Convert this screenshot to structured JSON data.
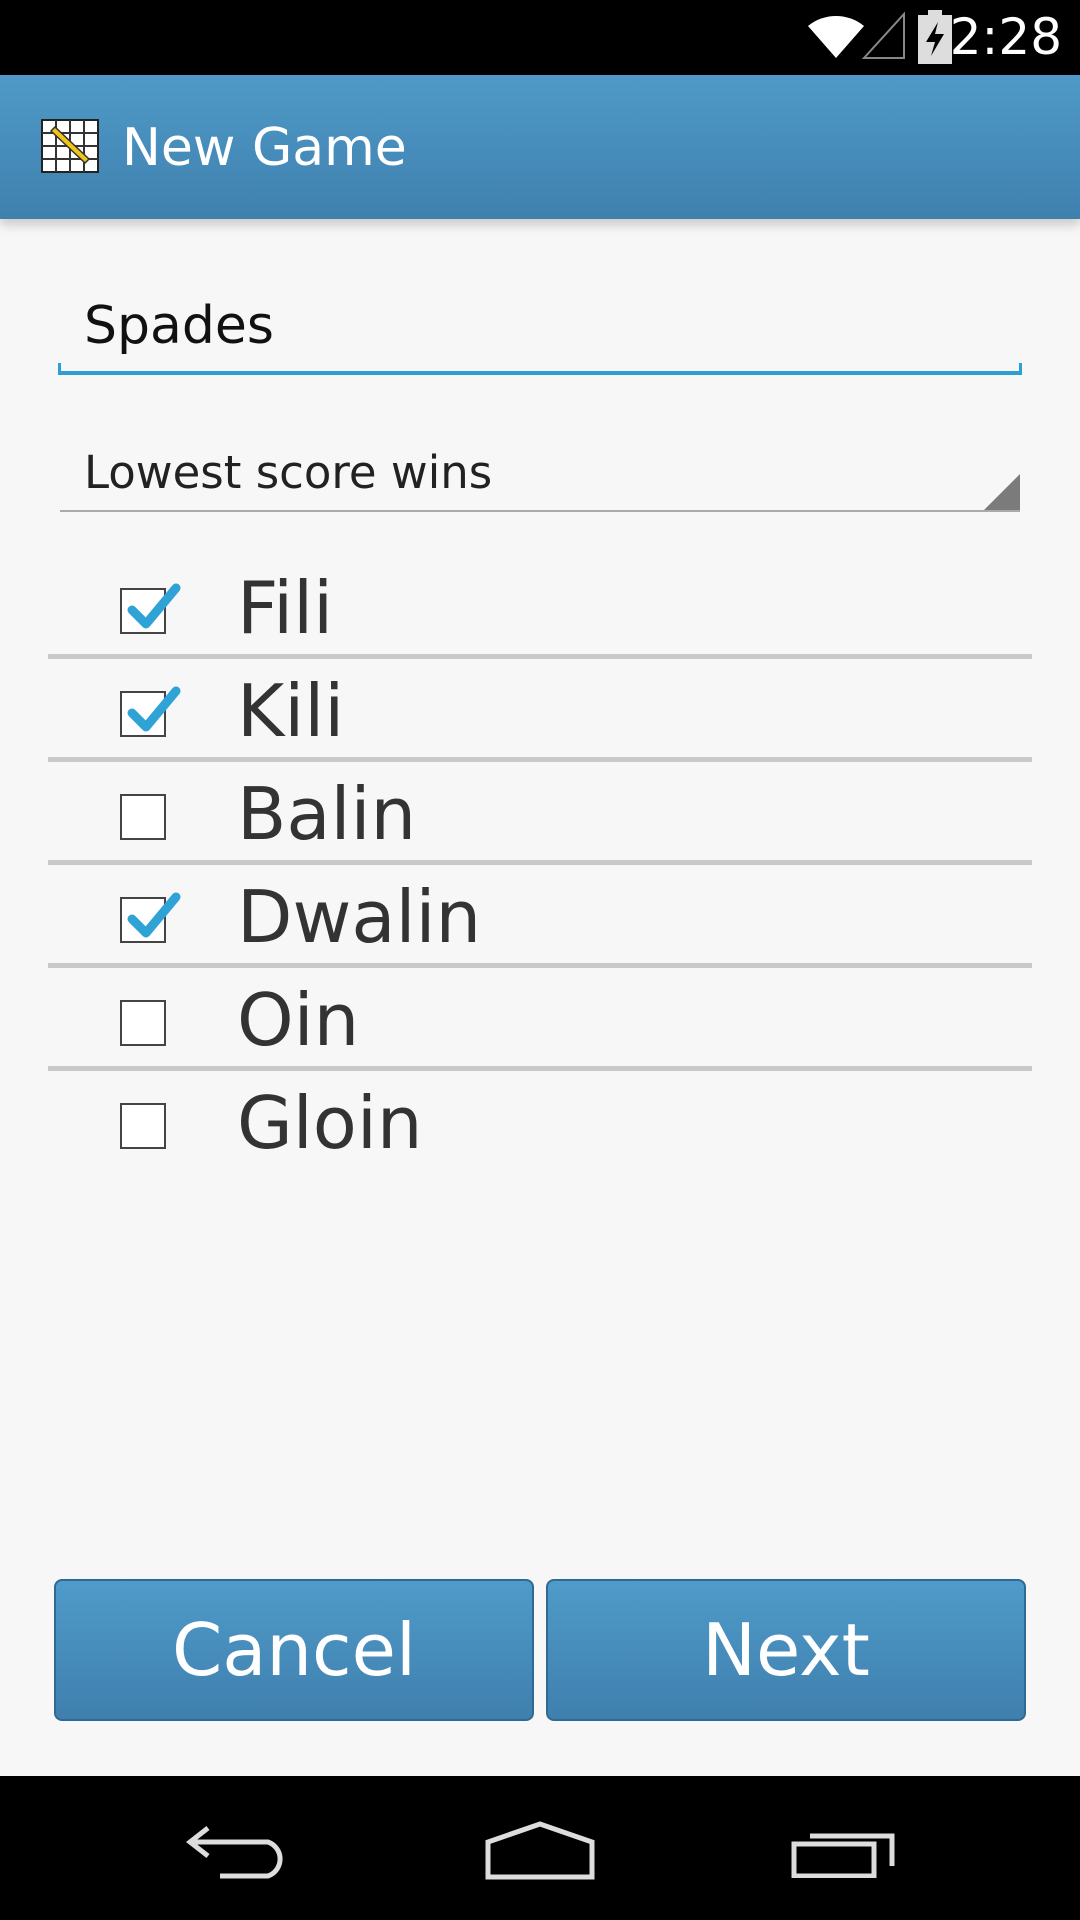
{
  "status_bar": {
    "time": "2:28",
    "icons": [
      "wifi-icon",
      "signal-icon",
      "battery-charging-icon"
    ]
  },
  "action_bar": {
    "title": "New Game",
    "icon": "app-scoresheet-icon"
  },
  "game_name": {
    "value": "Spades",
    "placeholder": ""
  },
  "scoring_spinner": {
    "selected": "Lowest score wins"
  },
  "players": [
    {
      "name": "Fili",
      "checked": true
    },
    {
      "name": "Kili",
      "checked": true
    },
    {
      "name": "Balin",
      "checked": false
    },
    {
      "name": "Dwalin",
      "checked": true
    },
    {
      "name": "Oin",
      "checked": false
    },
    {
      "name": "Gloin",
      "checked": false
    }
  ],
  "buttons": {
    "cancel": "Cancel",
    "next": "Next"
  },
  "nav_bar": {
    "icons": [
      "back-icon",
      "home-icon",
      "recent-apps-icon"
    ]
  },
  "colors": {
    "accent": "#33a5d8",
    "action_bar": "#4a90c0",
    "button": "#4689b8",
    "text": "#333333"
  }
}
